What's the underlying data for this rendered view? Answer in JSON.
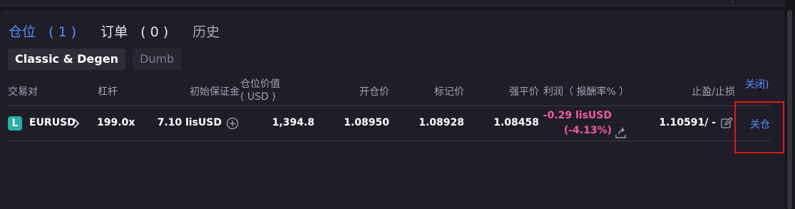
{
  "tabs": [
    {
      "label": "仓位",
      "count": "1"
    },
    {
      "label": "订单",
      "count": "0"
    },
    {
      "label": "历史"
    }
  ],
  "modes": [
    "Classic & Degen",
    "Dumb"
  ],
  "columns": {
    "pair": "交易对",
    "leverage": "杠杆",
    "initial_margin": "初始保证金",
    "position_value": "仓位价值",
    "position_value_unit": "( USD )",
    "open_price": "开仓价",
    "mark_price": "标记价",
    "liq_price": "强平价",
    "pnl": "利润（ 报酬率% ）",
    "tp_sl": "止盈/止损",
    "close": "关闭)"
  },
  "position": {
    "icon_letter": "L",
    "symbol": "EURUSD",
    "leverage": "199.0x",
    "margin": "7.10 lisUSD",
    "value": "1,394.8",
    "open_price": "1.08950",
    "mark_price": "1.08928",
    "liq_price": "1.08458",
    "pnl": "-0.29 lisUSD",
    "pnl_pct": "(-4.13%)",
    "tp_sl": "1.10591/ -",
    "close_label": "关仓"
  },
  "colors": {
    "accent": "#5b8dff",
    "loss": "#f25ca6",
    "symbol_icon": "#26b3a3",
    "highlight_box": "#e1171b"
  },
  "icons": {
    "symbol": "letter-L-icon",
    "symbol_chevron": "chevron-right-icon",
    "add_margin": "plus-circle-icon",
    "share": "share-icon",
    "edit": "edit-icon"
  }
}
